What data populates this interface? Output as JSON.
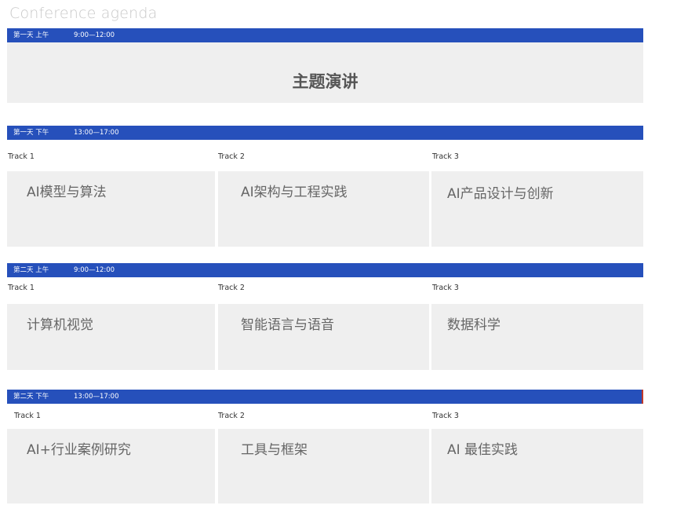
{
  "page": {
    "title": "Conference agenda"
  },
  "sessions": [
    {
      "day": "第一天 上午",
      "time": "9:00—12:00",
      "keynote": "主题演讲"
    },
    {
      "day": "第一天 下午",
      "time": "13:00—17:00",
      "tracks": [
        {
          "label": "Track 1",
          "topic": "AI模型与算法"
        },
        {
          "label": "Track 2",
          "topic": "AI架构与工程实践"
        },
        {
          "label": "Track 3",
          "topic": "AI产品设计与创新"
        }
      ]
    },
    {
      "day": "第二天 上午",
      "time": "9:00—12:00",
      "tracks": [
        {
          "label": "Track 1",
          "topic": "计算机视觉"
        },
        {
          "label": "Track 2",
          "topic": "智能语言与语音"
        },
        {
          "label": "Track 3",
          "topic": "数据科学"
        }
      ]
    },
    {
      "day": "第二天 下午",
      "time": "13:00—17:00",
      "tracks": [
        {
          "label": "Track 1",
          "topic": "AI+行业案例研究"
        },
        {
          "label": "Track 2",
          "topic": "工具与框架"
        },
        {
          "label": "Track 3",
          "topic": "AI 最佳实践"
        }
      ]
    }
  ],
  "colors": {
    "header_bar": "#2650bb",
    "box_bg": "#efefef",
    "title": "#c9c9c9"
  }
}
